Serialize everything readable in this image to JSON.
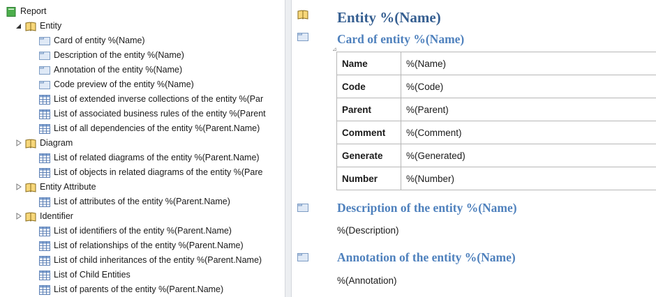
{
  "tree": {
    "root_label": "Report",
    "items": [
      {
        "label": "Entity",
        "level": 1,
        "icon": "book-icon",
        "expander": "expanded"
      },
      {
        "label": "Card of entity %(Name)",
        "level": 2,
        "icon": "folder-icon"
      },
      {
        "label": "Description of the entity %(Name)",
        "level": 2,
        "icon": "folder-icon"
      },
      {
        "label": "Annotation of the entity %(Name)",
        "level": 2,
        "icon": "folder-icon"
      },
      {
        "label": "Code preview of the entity %(Name)",
        "level": 2,
        "icon": "folder-icon"
      },
      {
        "label": "List of extended inverse collections of the entity %(Par",
        "level": 2,
        "icon": "table-icon"
      },
      {
        "label": "List of associated business rules of the entity %(Parent",
        "level": 2,
        "icon": "table-icon"
      },
      {
        "label": "List of all dependencies of the entity %(Parent.Name)",
        "level": 2,
        "icon": "table-icon"
      },
      {
        "label": "Diagram",
        "level": 1,
        "icon": "book-icon",
        "expander": "collapsed"
      },
      {
        "label": "List of related diagrams of the entity %(Parent.Name)",
        "level": 2,
        "icon": "table-icon"
      },
      {
        "label": "List of objects in related diagrams of the entity %(Pare",
        "level": 2,
        "icon": "table-icon"
      },
      {
        "label": "Entity Attribute",
        "level": 1,
        "icon": "book-icon",
        "expander": "collapsed"
      },
      {
        "label": "List of attributes of the entity %(Parent.Name)",
        "level": 2,
        "icon": "table-icon"
      },
      {
        "label": "Identifier",
        "level": 1,
        "icon": "book-icon",
        "expander": "collapsed"
      },
      {
        "label": "List of identifiers of the entity %(Parent.Name)",
        "level": 2,
        "icon": "table-icon"
      },
      {
        "label": "List of relationships of the entity %(Parent.Name)",
        "level": 2,
        "icon": "table-icon"
      },
      {
        "label": "List of child inheritances of the entity %(Parent.Name)",
        "level": 2,
        "icon": "table-icon"
      },
      {
        "label": "List of Child Entities",
        "level": 2,
        "icon": "table-icon"
      },
      {
        "label": "List of parents of the entity %(Parent.Name)",
        "level": 2,
        "icon": "table-icon"
      }
    ]
  },
  "preview": {
    "title": "Entity %(Name)",
    "card_heading": "Card of entity %(Name)",
    "card_rows": [
      {
        "key": "Name",
        "value": "%(Name)"
      },
      {
        "key": "Code",
        "value": "%(Code)"
      },
      {
        "key": "Parent",
        "value": "%(Parent)"
      },
      {
        "key": "Comment",
        "value": "%(Comment)"
      },
      {
        "key": "Generate",
        "value": "%(Generated)"
      },
      {
        "key": "Number",
        "value": "%(Number)"
      }
    ],
    "description_heading": "Description of the entity %(Name)",
    "description_text": "%(Description)",
    "annotation_heading": "Annotation of the entity %(Name)",
    "annotation_text": "%(Annotation)"
  },
  "colors": {
    "heading_blue": "#4f81bd",
    "title_blue": "#365f91",
    "report_icon_green": "#3a9a3a",
    "folder_icon_blue": "#9bb7d9"
  }
}
